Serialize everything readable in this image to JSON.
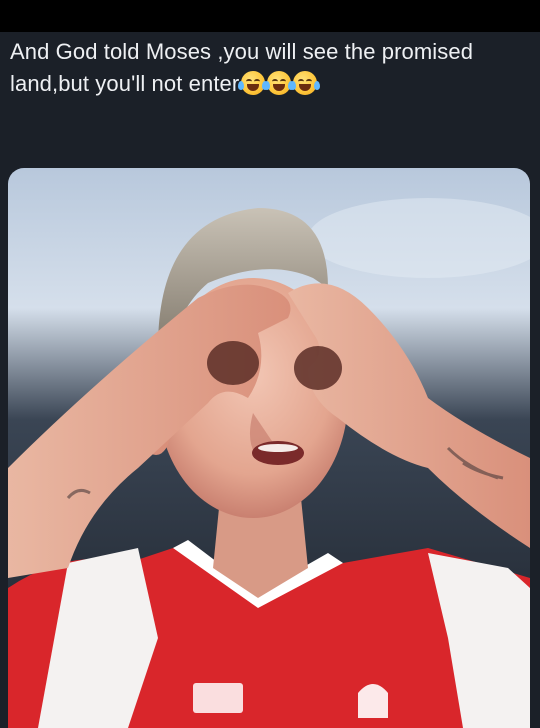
{
  "caption": {
    "text": "And God told Moses ,you will see the promised land,but you'll not enter"
  },
  "emojis": [
    {
      "icon": "face-with-tears-of-joy-icon"
    },
    {
      "icon": "face-with-tears-of-joy-icon"
    },
    {
      "icon": "face-with-tears-of-joy-icon"
    }
  ],
  "photo": {
    "subject": "footballer-cupping-hands-around-eyes",
    "kit_colors": {
      "shirt": "#d9262b",
      "sleeves": "#f4f2f1",
      "sky": "#c9d6e6",
      "background": "#1e2530"
    }
  }
}
